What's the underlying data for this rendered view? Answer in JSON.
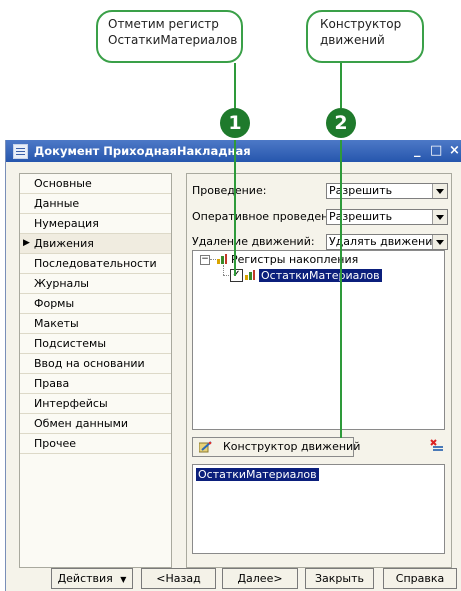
{
  "callouts": [
    {
      "number": "1",
      "lines": [
        "Отметим регистр",
        "ОстаткиМатериалов"
      ]
    },
    {
      "number": "2",
      "lines": [
        "Конструктор",
        "движений"
      ]
    }
  ],
  "window": {
    "title": "Документ ПриходнаяНакладная",
    "controls": {
      "minimize": "_",
      "maximize": "□",
      "close": "×"
    }
  },
  "sidebar": {
    "items": [
      {
        "label": "Основные"
      },
      {
        "label": "Данные"
      },
      {
        "label": "Нумерация"
      },
      {
        "label": "Движения",
        "active": true
      },
      {
        "label": "Последовательности"
      },
      {
        "label": "Журналы"
      },
      {
        "label": "Формы"
      },
      {
        "label": "Макеты"
      },
      {
        "label": "Подсистемы"
      },
      {
        "label": "Ввод на основании"
      },
      {
        "label": "Права"
      },
      {
        "label": "Интерфейсы"
      },
      {
        "label": "Обмен данными"
      },
      {
        "label": "Прочее"
      }
    ]
  },
  "settings": {
    "posting_label": "Проведение:",
    "posting_value": "Разрешить",
    "realtime_label": "Оперативное проведение:",
    "realtime_value": "Разрешить",
    "delete_label": "Удаление движений:",
    "delete_value": "Удалять движения автоматически"
  },
  "tree": {
    "root_label": "Регистры накопления",
    "child_label": "ОстаткиМатериалов",
    "child_checked": true
  },
  "constructor_button": "Конструктор движений",
  "list": {
    "items": [
      "ОстаткиМатериалов"
    ]
  },
  "buttons": {
    "actions": "Действия",
    "back": "<Назад",
    "next": "Далее>",
    "close": "Закрыть",
    "help": "Справка"
  },
  "colors": {
    "accent_green": "#1f7a2c",
    "title_bar": "#2c5fb8",
    "selection": "#0b1f7c"
  }
}
